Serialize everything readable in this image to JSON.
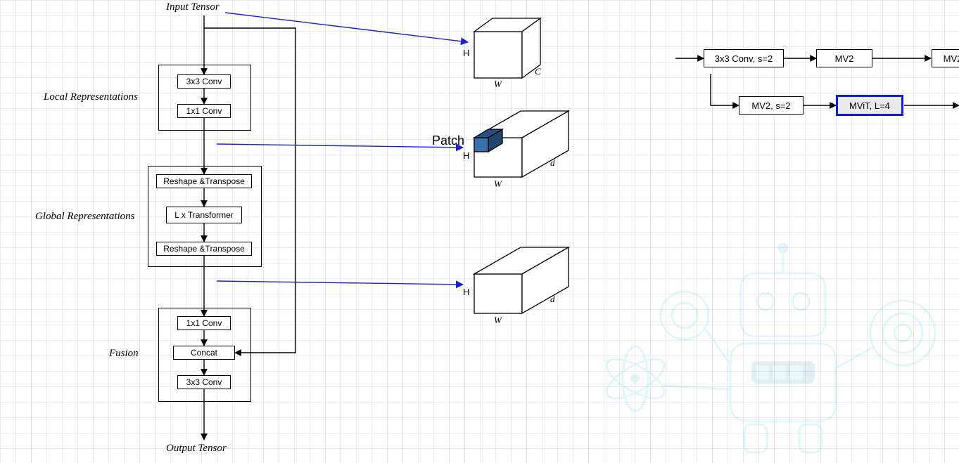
{
  "flow": {
    "input": "Input Tensor",
    "output": "Output Tensor",
    "local": {
      "title": "Local Representations",
      "b1": "3x3 Conv",
      "b2": "1x1 Conv"
    },
    "global": {
      "title": "Global Representations",
      "b1": "Reshape &Transpose",
      "b2": "L x Transformer",
      "b3": "Reshape &Transpose"
    },
    "fusion": {
      "title": "Fusion",
      "b1": "1x1 Conv",
      "b2": "Concat",
      "b3": "3x3 Conv"
    }
  },
  "tensors": {
    "patch": "Patch",
    "H": "H",
    "W": "W",
    "C": "C",
    "d": "d"
  },
  "pipeline": {
    "p1": "3x3 Conv, s=2",
    "p2": "MV2",
    "p3": "MV2",
    "p4": "MV2, s=2",
    "p5": "MViT, L=4"
  }
}
